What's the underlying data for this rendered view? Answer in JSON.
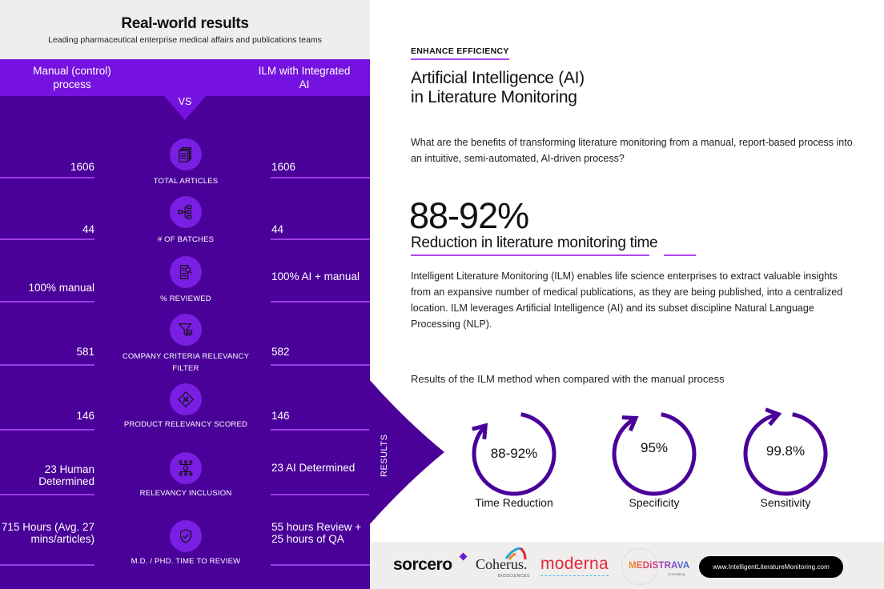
{
  "comparison": {
    "title": "Real-world results",
    "subtitle": "Leading pharmaceutical enterprise medical affairs and publications teams",
    "left_heading": "Manual (control) process",
    "right_heading": "ILM with Integrated AI",
    "vs_label": "VS",
    "rows": [
      {
        "label": "TOTAL ARTICLES",
        "icon": "documents-icon",
        "manual": "1606",
        "ai": "1606"
      },
      {
        "label": "# OF BATCHES",
        "icon": "hierarchy-icon",
        "manual": "44",
        "ai": "44"
      },
      {
        "label": "% REVIEWED",
        "icon": "document-search-icon",
        "manual": "100% manual",
        "ai": "100% AI + manual"
      },
      {
        "label": "COMPANY CRITERIA RELEVANCY FILTER",
        "icon": "filter-check-icon",
        "manual": "581",
        "ai": "582"
      },
      {
        "label": "PRODUCT RELEVANCY SCORED",
        "icon": "puzzle-diamond-icon",
        "manual": "146",
        "ai": "146"
      },
      {
        "label": "RELEVANCY INCLUSION",
        "icon": "network-icon",
        "manual": "23 Human Determined",
        "ai": "23 AI Determined"
      },
      {
        "label": "M.D. / PHD. TIME TO REVIEW",
        "icon": "shield-check-icon",
        "manual": "715 Hours (Avg. 27 mins/articles)",
        "ai": "55 hours Review + 25 hours of QA"
      }
    ],
    "results_label": "RESULTS"
  },
  "article": {
    "eyebrow": "ENHANCE EFFICIENCY",
    "title_line1": "Artificial Intelligence (AI)",
    "title_line2": "in Literature Monitoring",
    "intro": "What are the benefits of transforming literature monitoring from a manual, report-based process into an intuitive, semi-automated, AI-driven process?",
    "big_stat": "88-92%",
    "stat_caption": "Reduction in literature monitoring time",
    "body": "Intelligent Literature Monitoring (ILM) enables life science enterprises to extract valuable insights from an expansive number of medical publications, as they are being published, into a centralized location. ILM leverages Artificial Intelligence (AI) and its subset discipline Natural Language Processing (NLP).",
    "results_intro": "Results of the ILM method when compared with the manual process"
  },
  "metrics": [
    {
      "value": "88-92%",
      "label": "Time  Reduction",
      "fraction": 0.9
    },
    {
      "value": "95%",
      "label": "Specificity",
      "fraction": 0.95
    },
    {
      "value": "99.8%",
      "label": "Sensitivity",
      "fraction": 0.998
    }
  ],
  "footer": {
    "logos": {
      "sorcero": "sorcero",
      "coherus": "Coherus.",
      "coherus_sub": "BIOSCIENCES",
      "moderna": "moderna",
      "medistrava": "MEDiSTRAVA",
      "medistrava_sub": "Consulting"
    },
    "website": "www.IntelligentLiteratureMonitoring.com"
  },
  "colors": {
    "panel_dark": "#4a0199",
    "panel_band": "#7612df",
    "accent": "#b245f0",
    "ring": "#4a0199"
  }
}
